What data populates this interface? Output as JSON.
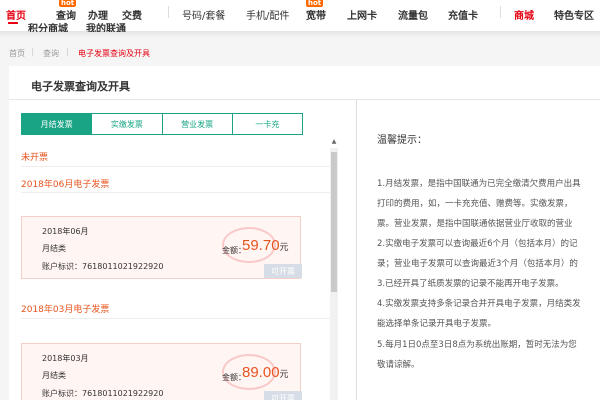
{
  "nav": {
    "row1": [
      "首页",
      "查询",
      "办理",
      "交费",
      "号码/套餐",
      "手机/配件",
      "宽带",
      "上网卡",
      "流量包",
      "充值卡",
      "商城",
      "特色专区"
    ],
    "row2": [
      "积分商城",
      "我的联通"
    ],
    "badge1": "hot",
    "badge2": "hot"
  },
  "breadcrumb": [
    "首页",
    "查询",
    "电子发票查询及开具"
  ],
  "page": {
    "title": "电子发票查询及开具"
  },
  "tabs": [
    "月结发票",
    "实缴发票",
    "营业发票",
    "一卡充"
  ],
  "section_unopened": "未开票",
  "invoices": [
    {
      "heading": "2018年06月电子发票",
      "date": "2018年06月",
      "type": "月结类",
      "account": "账户标识：7618011021922920",
      "amount_label": "金额：",
      "amount": "59.70",
      "unit": "元",
      "status": "可开票"
    },
    {
      "heading": "2018年03月电子发票",
      "date": "2018年03月",
      "type": "月结类",
      "account": "账户标识：7618011021922920",
      "amount_label": "金额：",
      "amount": "89.00",
      "unit": "元",
      "status": "可开票"
    }
  ],
  "tips": {
    "title": "温馨提示：",
    "lines": [
      "1.月结发票，是指中国联通为已完全缴清欠费用户出具",
      "打印的费用，如，一卡充充值、赠费等。实缴发票，",
      "票。营业发票，是指中国联通依据营业厅收取的营业",
      "2.实缴电子发票可以查询最近6个月（包括本月）的记",
      "录；营业电子发票可以查询最近3个月（包括本月）的",
      "3.已经开具了纸质发票的记录不能再开电子发票。",
      "4.实缴发票支持多条记录合并开具电子发票，月结类发",
      "能选择单条记录开具电子发票。",
      "5.每月1日0点至3日8点为系统出账期，暂时无法为您",
      "敬请谅解。"
    ]
  },
  "colors": {
    "accent": "#19a585",
    "brand": "#e60012",
    "amount": "#e8541e"
  }
}
